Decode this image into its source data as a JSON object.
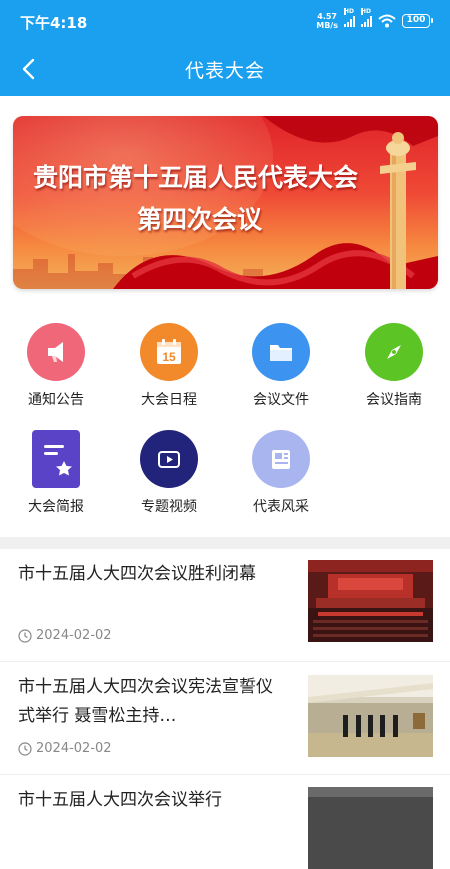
{
  "status_bar": {
    "time": "下午4:18",
    "net_speed": "4.57",
    "net_unit": "MB/s",
    "signal1_tag": "HD",
    "signal2_tag": "HD",
    "battery": "100"
  },
  "nav": {
    "back_icon": "chevron-left-icon",
    "title": "代表大会"
  },
  "banner": {
    "line1": "贵阳市第十五届人民代表大会",
    "line2": "第四次会议"
  },
  "menu": [
    {
      "label": "通知公告",
      "icon": "megaphone-icon",
      "color": "#f0677a"
    },
    {
      "label": "大会日程",
      "icon": "calendar-icon",
      "color": "#f28a2c",
      "day": "15"
    },
    {
      "label": "会议文件",
      "icon": "folder-icon",
      "color": "#3c93f0"
    },
    {
      "label": "会议指南",
      "icon": "compass-icon",
      "color": "#5cc424"
    },
    {
      "label": "大会简报",
      "icon": "document-star-icon",
      "color": "#5b43c7"
    },
    {
      "label": "专题视频",
      "icon": "video-play-icon",
      "color": "#22237a"
    },
    {
      "label": "代表风采",
      "icon": "newspaper-icon",
      "color": "#a9b5ee"
    }
  ],
  "news": [
    {
      "title": "市十五届人大四次会议胜利闭幕",
      "date": "2024-02-02",
      "image": "meeting-hall-photo"
    },
    {
      "title": "市十五届人大四次会议宪法宣誓仪式举行 聂雪松主持…",
      "date": "2024-02-02",
      "image": "oath-ceremony-photo"
    },
    {
      "title": "市十五届人大四次会议举行",
      "date": "",
      "image": "meeting-photo"
    }
  ]
}
